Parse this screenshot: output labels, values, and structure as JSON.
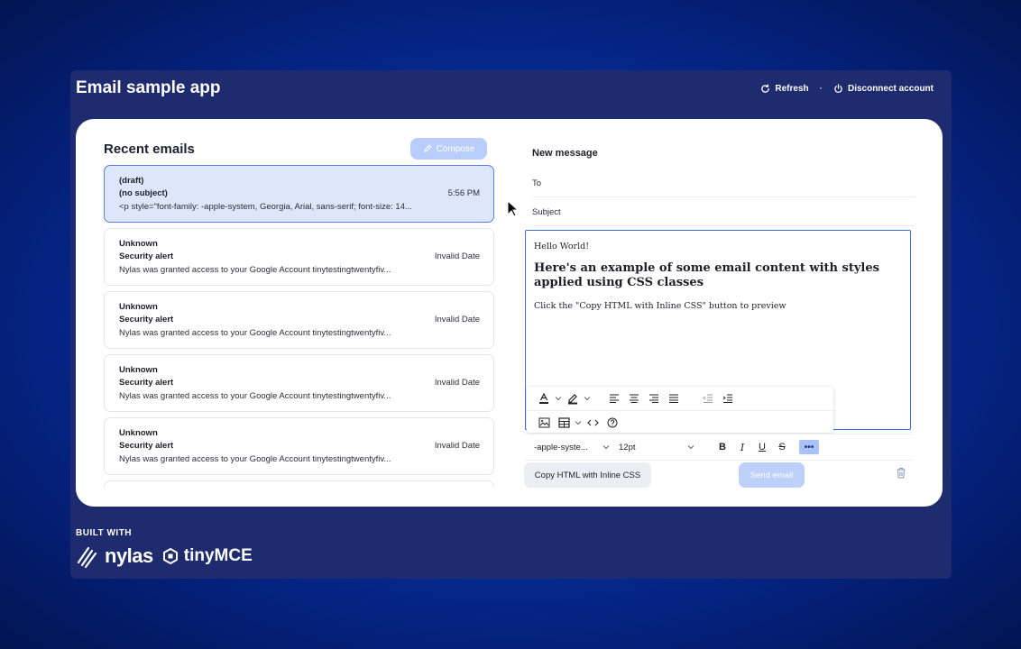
{
  "header": {
    "title": "Email sample app",
    "refresh_label": "Refresh",
    "separator": "·",
    "disconnect_label": "Disconnect account"
  },
  "email_list": {
    "title": "Recent emails",
    "compose_label": "Compose",
    "items": [
      {
        "from": "(draft)",
        "subject": "(no subject)",
        "snippet": "<p style=\"font-family: -apple-system, Georgia, Arial, sans-serif; font-size: 14...",
        "date": "5:56 PM"
      },
      {
        "from": "Unknown",
        "subject": "Security alert",
        "snippet": "Nylas was granted access to your Google Account tinytestingtwentyfiv...",
        "date": "Invalid Date"
      },
      {
        "from": "Unknown",
        "subject": "Security alert",
        "snippet": "Nylas was granted access to your Google Account tinytestingtwentyfiv...",
        "date": "Invalid Date"
      },
      {
        "from": "Unknown",
        "subject": "Security alert",
        "snippet": "Nylas was granted access to your Google Account tinytestingtwentyfiv...",
        "date": "Invalid Date"
      },
      {
        "from": "Unknown",
        "subject": "Security alert",
        "snippet": "Nylas was granted access to your Google Account tinytestingtwentyfiv...",
        "date": "Invalid Date"
      }
    ]
  },
  "composer": {
    "title": "New message",
    "to_placeholder": "To",
    "subject_placeholder": "Subject",
    "editor": {
      "line1": "Hello World!",
      "heading": "Here's an example of some email content with styles applied using CSS classes",
      "line2": "Click the \"Copy HTML with Inline CSS\" button to preview"
    },
    "font_family": "-apple-syste...",
    "font_size": "12pt",
    "bold": "B",
    "italic": "I",
    "underline": "U",
    "strike": "S",
    "more": "•••",
    "copy_label": "Copy HTML with Inline CSS",
    "send_label": "Send email"
  },
  "footer": {
    "built_with": "BUILT WITH",
    "nylas": "nylas",
    "tinymce": "tinyMCE"
  },
  "colors": {
    "accent": "#3d6ee0",
    "frame": "#1e2b6e",
    "selected_bg": "#dde6fb",
    "compose_bg": "#b9cdfa"
  }
}
